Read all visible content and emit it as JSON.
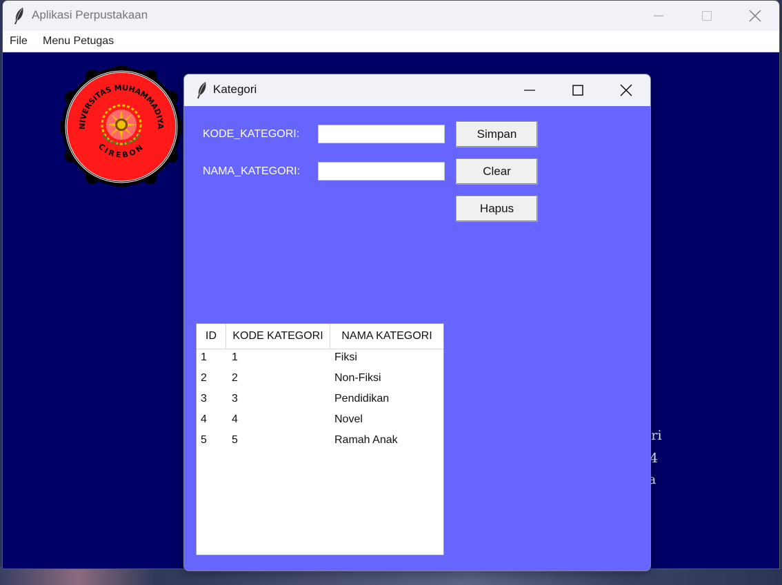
{
  "main_window": {
    "title": "Aplikasi Perpustakaan",
    "menu": [
      "File",
      "Menu Petugas"
    ],
    "background_color": "#000066",
    "logo": {
      "top_text": "UNIVERSITAS MUHAMMADIYAH",
      "bottom_text": "CIREBON",
      "colors": {
        "fill": "#ff1a1a",
        "ring": "#000000",
        "emblem": "#f5c000"
      }
    },
    "partial_text": [
      "fari",
      "4",
      "a"
    ]
  },
  "dialog": {
    "title": "Kategori",
    "background_color": "#6666ff",
    "form": {
      "kode_label": "KODE_KATEGORI:",
      "kode_value": "",
      "nama_label": "NAMA_KATEGORI:",
      "nama_value": ""
    },
    "buttons": {
      "simpan": "Simpan",
      "clear": "Clear",
      "hapus": "Hapus"
    },
    "table": {
      "columns": [
        "ID",
        "KODE KATEGORI",
        "NAMA KATEGORI"
      ],
      "rows": [
        [
          "1",
          "1",
          "Fiksi"
        ],
        [
          "2",
          "2",
          "Non-Fiksi"
        ],
        [
          "3",
          "3",
          "Pendidikan"
        ],
        [
          "4",
          "4",
          "Novel"
        ],
        [
          "5",
          "5",
          "Ramah Anak"
        ]
      ]
    }
  }
}
